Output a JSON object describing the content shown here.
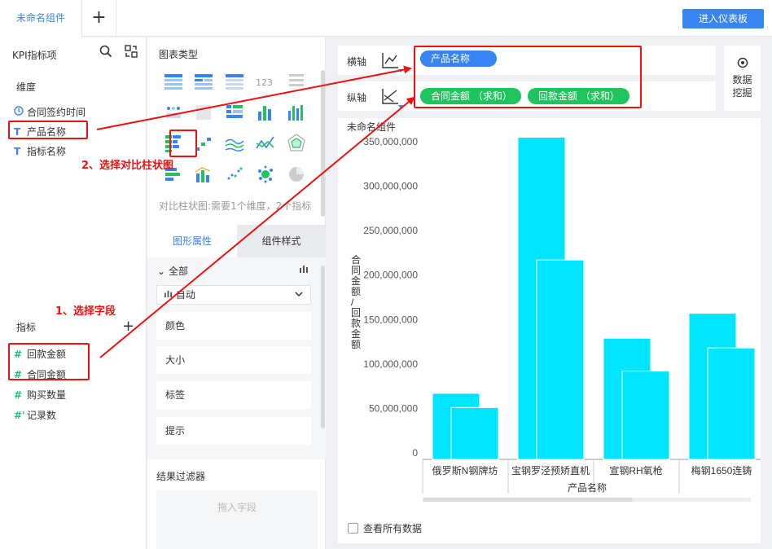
{
  "top": {
    "tab_label": "未命名组件",
    "add_tab": "+",
    "dashboard_button": "进入仪表板"
  },
  "left_panel": {
    "title": "KPI指标项",
    "search_icon": "search-icon",
    "switch_icon": "switch-icon",
    "dimension_label": "维度",
    "dimensions": [
      {
        "icon": "clock-icon",
        "label": "合同签约时间"
      },
      {
        "icon": "T",
        "label": "产品名称"
      },
      {
        "icon": "T",
        "label": "指标名称"
      }
    ],
    "measure_label": "指标",
    "add_measure": "+",
    "measures": [
      {
        "icon": "#",
        "label": "回款金额"
      },
      {
        "icon": "#",
        "label": "合同金额"
      },
      {
        "icon": "#",
        "label": "购买数量"
      },
      {
        "icon": "#'",
        "label": "记录数"
      }
    ]
  },
  "mid_panel": {
    "chart_type_title": "图表类型",
    "chart_type_hint": "对比柱状图:需要1个维度，2个指标",
    "tab_graphic": "图形属性",
    "tab_style": "组件样式",
    "all_label": "全部",
    "auto_label": "自动",
    "properties": [
      "颜色",
      "大小",
      "标签",
      "提示"
    ],
    "filter_title": "结果过滤器",
    "filter_placeholder": "拖入字段"
  },
  "right_panel": {
    "x_axis_label": "横轴",
    "y_axis_label": "纵轴",
    "x_pill": "产品名称",
    "y_pills": [
      "合同金额 （求和）",
      "回款金额 （求和）"
    ],
    "mining_label_1": "数据",
    "mining_label_2": "挖掘",
    "see_all": "查看所有数据"
  },
  "annotations": {
    "step1": "1、选择字段",
    "step2": "2、选择对比柱状图"
  },
  "colors": {
    "accent": "#3685f2",
    "green": "#1ec55e",
    "bar": "#00e5ff",
    "annotation": "#e11111"
  },
  "chart_data": {
    "type": "bar",
    "title": "未命名组件",
    "xlabel": "产品名称",
    "ylabel": "合同金额/回款金额",
    "categories": [
      "俄罗斯N钢牌坊",
      "宝钢罗泾预矫直机",
      "宣钢RH氧枪",
      "梅钢1650连铸"
    ],
    "series": [
      {
        "name": "合同金额",
        "values": [
          67000000,
          355000000,
          129000000,
          157000000
        ]
      },
      {
        "name": "回款金额",
        "values": [
          51000000,
          217000000,
          92000000,
          118000000
        ]
      }
    ],
    "ylim": [
      0,
      350000000
    ],
    "yticks": [
      "0",
      "50,000,000",
      "100,000,000",
      "150,000,000",
      "200,000,000",
      "250,000,000",
      "300,000,000",
      "350,000,000"
    ],
    "grid": false
  }
}
